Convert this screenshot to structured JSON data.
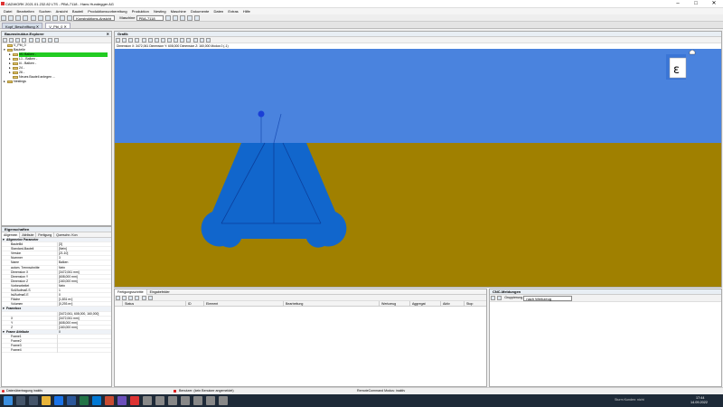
{
  "app": {
    "title": "CADWORK 2021.01.232.82 LTS - PBA-7118 - Hans Hundegger AG",
    "window_controls": [
      "–",
      "□",
      "✕"
    ]
  },
  "menu": [
    "Datei",
    "Bearbeiten",
    "Suchen",
    "Ansicht",
    "Bauteil",
    "Produktionsvorbereitung",
    "Produktion",
    "Nesting",
    "Maschine",
    "Dokumente",
    "Daten",
    "Extras",
    "Hilfe"
  ],
  "toolbar": {
    "view_combo": "Konstruktions-Ansicht",
    "machine_label": "Maschine",
    "machine_combo": "PBA-7118"
  },
  "doc_tabs": [
    "Kopf_Beschriftung ✕",
    "V_Pbi_0 ✕"
  ],
  "explorer": {
    "title": "Baumstruktur-Explorer",
    "tree": [
      {
        "indent": 0,
        "twisty": "",
        "label": "V_Pbi_0"
      },
      {
        "indent": 0,
        "twisty": "▾",
        "label": "Bauteile"
      },
      {
        "indent": 1,
        "twisty": "▸",
        "label": "nf1 Balken -",
        "selected": true
      },
      {
        "indent": 1,
        "twisty": "▸",
        "label": "L1 - Balken -"
      },
      {
        "indent": 1,
        "twisty": "▸",
        "label": "l4 - Balken -"
      },
      {
        "indent": 1,
        "twisty": "▸",
        "label": "24 -"
      },
      {
        "indent": 1,
        "twisty": "▸",
        "label": "26 -"
      },
      {
        "indent": 1,
        "twisty": "",
        "label": "Neues Bauteil anlegen ..."
      },
      {
        "indent": 0,
        "twisty": "▸",
        "label": "Nestings"
      }
    ]
  },
  "graphics": {
    "title": "Grafik",
    "infobar": "Dimension X: 3472,061   Dimension Y: 608,000   Dimension Z: 160,000 Modus 0 (-1)",
    "nav_letter": "ε",
    "sky_color": "#4a83de",
    "ground_color": "#a08000",
    "part_color": "#1166cc"
  },
  "properties": {
    "title": "Eigenschaften",
    "tabs": [
      "Allgemein",
      "Attribute",
      "Fertigung",
      "Querschn. Kon"
    ],
    "section": "Allgemeine Parameter",
    "rows": [
      {
        "k": "BauteilId",
        "v": "[3]"
      },
      {
        "k": "Standard-Bauteil",
        "v": "[Nein]"
      },
      {
        "k": "Version",
        "v": "[21.10]"
      },
      {
        "k": "Nummer",
        "v": "3"
      },
      {
        "k": "Name",
        "v": "Balken"
      },
      {
        "k": "autom. Trennschnitte",
        "v": "Nein"
      },
      {
        "k": "Dimension X",
        "v": "[3472,061 mm]"
      },
      {
        "k": "Dimension Y",
        "v": "[608,000 mm]"
      },
      {
        "k": "Dimension Z",
        "v": "[160,000 mm]"
      },
      {
        "k": "Vorbearbeitet",
        "v": "Nein"
      },
      {
        "k": "Soll/Aufmaß S",
        "v": "1"
      },
      {
        "k": "Ist/Aufmaß E",
        "v": "0"
      },
      {
        "k": "Fläche",
        "v": "[1,831 m²]"
      },
      {
        "k": "Volumen",
        "v": "[0,293 m³]"
      }
    ],
    "section2": "Framebox",
    "rows2": [
      {
        "k": "",
        "v": "[3472,061, 608,000, 160,000]"
      },
      {
        "k": "X",
        "v": "[3472,061 mm]"
      },
      {
        "k": "Y",
        "v": "[608,000 mm]"
      },
      {
        "k": "Z",
        "v": "[160,000 mm]"
      }
    ],
    "section3": "Frame Attribute",
    "rows3": [
      {
        "k": "Frame1",
        "v": ""
      },
      {
        "k": "Frame2",
        "v": ""
      },
      {
        "k": "Frame3",
        "v": ""
      },
      {
        "k": "Frame4",
        "v": ""
      }
    ],
    "frame_attr_value": "0"
  },
  "fertigung": {
    "tabs": [
      "Fertigungsschritte",
      "Eingabefelder"
    ],
    "columns": [
      "Status",
      "ID",
      "Element",
      "Bearbeitung",
      "Werkzeug",
      "Aggregat",
      "Aktiv",
      "Stop"
    ]
  },
  "cnc": {
    "title": "CNC-Meldungen",
    "group_label": "Gruppierung",
    "group_value": "nach Werkzeug"
  },
  "statusbar": {
    "left": "Datenübertragung inaktiv",
    "mid": "Benutzer: (kein Benutzer angemeldet)",
    "right": "RemoteCommand Modus: inaktiv"
  },
  "taskbar": {
    "time": "17:44",
    "date": "14.09.2022",
    "tray_text": "Sturm   Kunden: nicht"
  }
}
